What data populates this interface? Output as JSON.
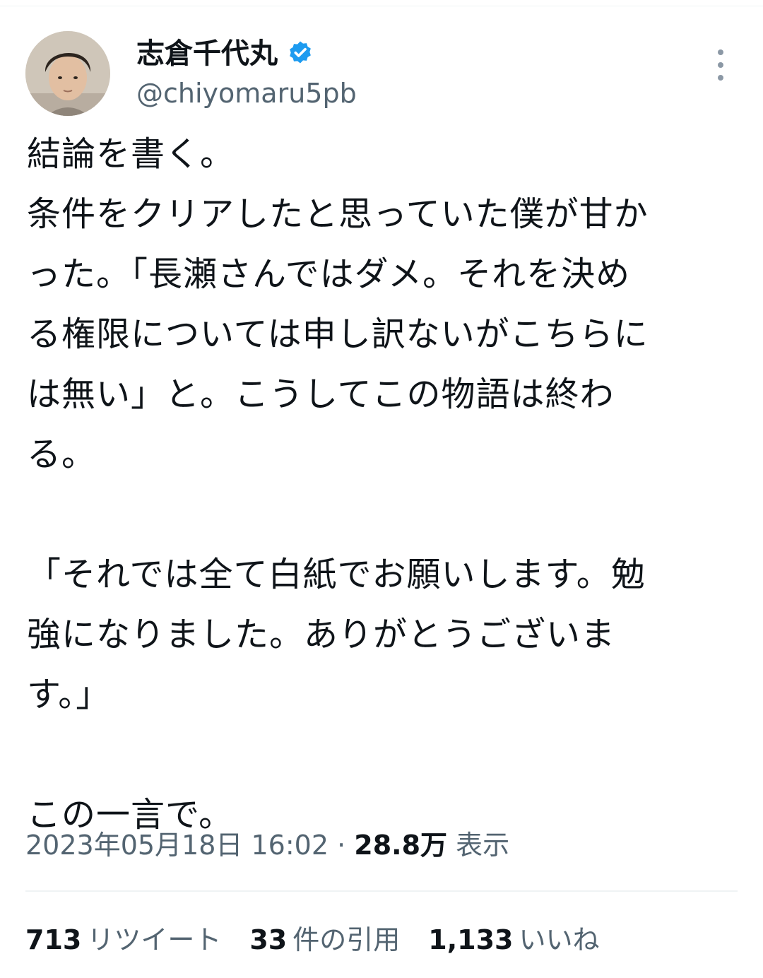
{
  "author": {
    "display_name": "志倉千代丸",
    "handle": "@chiyomaru5pb",
    "verified_icon": "verified-badge-icon",
    "accent_color": "#1d9bf0"
  },
  "tweet": {
    "paragraphs": [
      [
        "結論を書く。",
        "条件をクリアしたと思っていた僕が甘か",
        "った。「長瀬さんではダメ。それを決め",
        "る権限については申し訳ないがこちらに",
        "は無い」と。こうしてこの物語は終わ",
        "る。"
      ],
      [
        "「それでは全て白紙でお願いします。勉",
        "強になりました。ありがとうございま",
        "す。」"
      ],
      [
        "この一言で。"
      ]
    ]
  },
  "meta": {
    "timestamp": "2023年05月18日 16:02",
    "separator": "·",
    "views_count": "28.8万",
    "views_label": "表示"
  },
  "stats": {
    "retweets": {
      "count": "713",
      "label": "リツイート"
    },
    "quotes": {
      "count": "33",
      "label": "件の引用"
    },
    "likes": {
      "count": "1,133",
      "label": "いいね"
    }
  },
  "more_icon": "more-vertical-icon"
}
